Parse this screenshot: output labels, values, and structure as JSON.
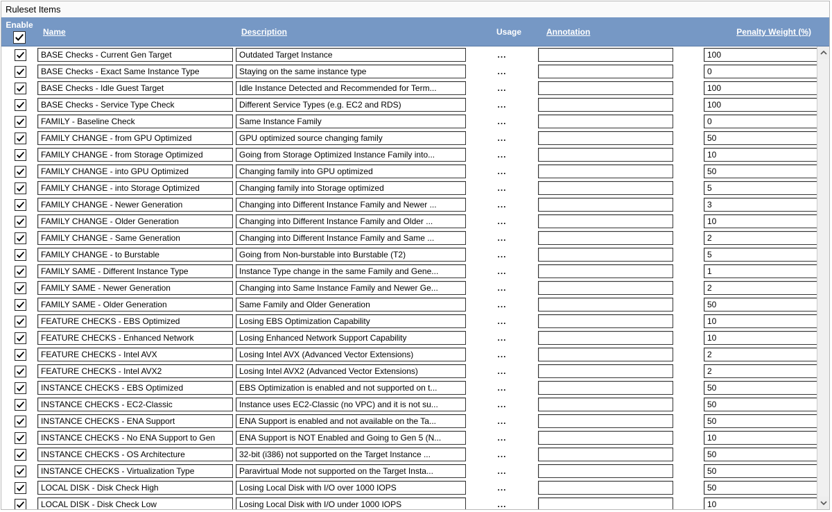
{
  "panel_title": "Ruleset Items",
  "headers": {
    "enable": "Enable",
    "name": "Name",
    "description": "Description",
    "usage": "Usage",
    "annotation": "Annotation",
    "penalty": "Penalty Weight (%)"
  },
  "master_checked": true,
  "rows": [
    {
      "checked": true,
      "name": "BASE Checks - Current Gen Target",
      "description": "Outdated Target Instance",
      "usage": "...",
      "annotation": "",
      "penalty": "100"
    },
    {
      "checked": true,
      "name": "BASE Checks - Exact Same Instance Type",
      "description": "Staying on the same instance type",
      "usage": "...",
      "annotation": "",
      "penalty": "0"
    },
    {
      "checked": true,
      "name": "BASE Checks - Idle Guest Target",
      "description": "Idle Instance Detected and Recommended for Term...",
      "usage": "...",
      "annotation": "",
      "penalty": "100"
    },
    {
      "checked": true,
      "name": "BASE Checks - Service Type Check",
      "description": "Different Service Types (e.g. EC2 and RDS)",
      "usage": "...",
      "annotation": "",
      "penalty": "100"
    },
    {
      "checked": true,
      "name": "FAMILY - Baseline Check",
      "description": "Same Instance Family",
      "usage": "...",
      "annotation": "",
      "penalty": "0"
    },
    {
      "checked": true,
      "name": "FAMILY CHANGE - from GPU Optimized",
      "description": "GPU optimized source changing family",
      "usage": "...",
      "annotation": "",
      "penalty": "50"
    },
    {
      "checked": true,
      "name": "FAMILY CHANGE - from Storage Optimized",
      "description": "Going from Storage Optimized Instance Family into...",
      "usage": "...",
      "annotation": "",
      "penalty": "10"
    },
    {
      "checked": true,
      "name": "FAMILY CHANGE - into GPU Optimized",
      "description": "Changing family into GPU optimized",
      "usage": "...",
      "annotation": "",
      "penalty": "50"
    },
    {
      "checked": true,
      "name": "FAMILY CHANGE - into Storage Optimized",
      "description": "Changing family into Storage optimized",
      "usage": "...",
      "annotation": "",
      "penalty": "5"
    },
    {
      "checked": true,
      "name": "FAMILY CHANGE - Newer Generation",
      "description": "Changing into Different Instance Family and Newer ...",
      "usage": "...",
      "annotation": "",
      "penalty": "3"
    },
    {
      "checked": true,
      "name": "FAMILY CHANGE - Older Generation",
      "description": "Changing into Different Instance Family and Older ...",
      "usage": "...",
      "annotation": "",
      "penalty": "10"
    },
    {
      "checked": true,
      "name": "FAMILY CHANGE - Same Generation",
      "description": "Changing into Different Instance Family and Same ...",
      "usage": "...",
      "annotation": "",
      "penalty": "2"
    },
    {
      "checked": true,
      "name": "FAMILY CHANGE - to Burstable",
      "description": "Going from Non-burstable into Burstable (T2)",
      "usage": "...",
      "annotation": "",
      "penalty": "5"
    },
    {
      "checked": true,
      "name": "FAMILY SAME - Different Instance Type",
      "description": "Instance Type change in the same Family and Gene...",
      "usage": "...",
      "annotation": "",
      "penalty": "1"
    },
    {
      "checked": true,
      "name": "FAMILY SAME - Newer Generation",
      "description": "Changing into Same Instance Family and Newer Ge...",
      "usage": "...",
      "annotation": "",
      "penalty": "2"
    },
    {
      "checked": true,
      "name": "FAMILY SAME - Older Generation",
      "description": "Same Family and Older Generation",
      "usage": "...",
      "annotation": "",
      "penalty": "50"
    },
    {
      "checked": true,
      "name": "FEATURE CHECKS - EBS Optimized",
      "description": "Losing EBS Optimization Capability",
      "usage": "...",
      "annotation": "",
      "penalty": "10"
    },
    {
      "checked": true,
      "name": "FEATURE CHECKS - Enhanced Network",
      "description": "Losing Enhanced Network Support Capability",
      "usage": "...",
      "annotation": "",
      "penalty": "10"
    },
    {
      "checked": true,
      "name": "FEATURE CHECKS - Intel AVX",
      "description": "Losing Intel AVX (Advanced Vector Extensions)",
      "usage": "...",
      "annotation": "",
      "penalty": "2"
    },
    {
      "checked": true,
      "name": "FEATURE CHECKS - Intel AVX2",
      "description": "Losing Intel AVX2 (Advanced Vector Extensions)",
      "usage": "...",
      "annotation": "",
      "penalty": "2"
    },
    {
      "checked": true,
      "name": "INSTANCE CHECKS - EBS Optimized",
      "description": "EBS Optimization is enabled and not supported on t...",
      "usage": "...",
      "annotation": "",
      "penalty": "50"
    },
    {
      "checked": true,
      "name": "INSTANCE CHECKS - EC2-Classic",
      "description": "Instance uses EC2-Classic (no VPC) and it is not su...",
      "usage": "...",
      "annotation": "",
      "penalty": "50"
    },
    {
      "checked": true,
      "name": "INSTANCE CHECKS - ENA Support",
      "description": "ENA Support is enabled and not available on the Ta...",
      "usage": "...",
      "annotation": "",
      "penalty": "50"
    },
    {
      "checked": true,
      "name": "INSTANCE CHECKS - No ENA Support to Gen",
      "description": "ENA Support is NOT Enabled and Going to Gen 5 (N...",
      "usage": "...",
      "annotation": "",
      "penalty": "10"
    },
    {
      "checked": true,
      "name": "INSTANCE CHECKS - OS Architecture",
      "description": "32-bit (i386) not supported on the Target Instance ...",
      "usage": "...",
      "annotation": "",
      "penalty": "50"
    },
    {
      "checked": true,
      "name": "INSTANCE CHECKS - Virtualization Type",
      "description": "Paravirtual Mode not supported on the Target Insta...",
      "usage": "...",
      "annotation": "",
      "penalty": "50"
    },
    {
      "checked": true,
      "name": "LOCAL DISK - Disk Check High",
      "description": "Losing Local Disk with I/O over 1000 IOPS",
      "usage": "...",
      "annotation": "",
      "penalty": "50"
    },
    {
      "checked": true,
      "name": "LOCAL DISK - Disk Check Low",
      "description": "Losing Local Disk with I/O under 1000 IOPS",
      "usage": "...",
      "annotation": "",
      "penalty": "10"
    }
  ]
}
